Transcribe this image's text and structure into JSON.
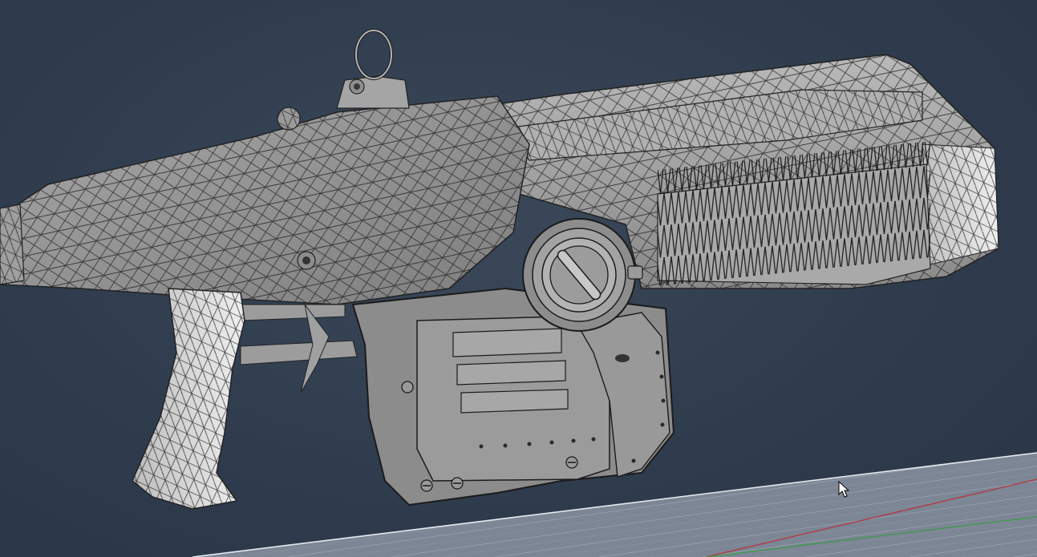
{
  "app": {
    "viewport_label": ""
  },
  "scene": {
    "object": "rifle-wireframe-model",
    "shading": "solid+wireframe",
    "background_color": "#2f3c4d",
    "mesh_color": "#9c9c9c",
    "wire_color": "#1e1e1e",
    "grid_color": "#9aa3b3",
    "x_axis_color": "#b23a48",
    "y_axis_color": "#3a9a48"
  },
  "cursor": {
    "icon": "arrow-cursor-icon"
  }
}
